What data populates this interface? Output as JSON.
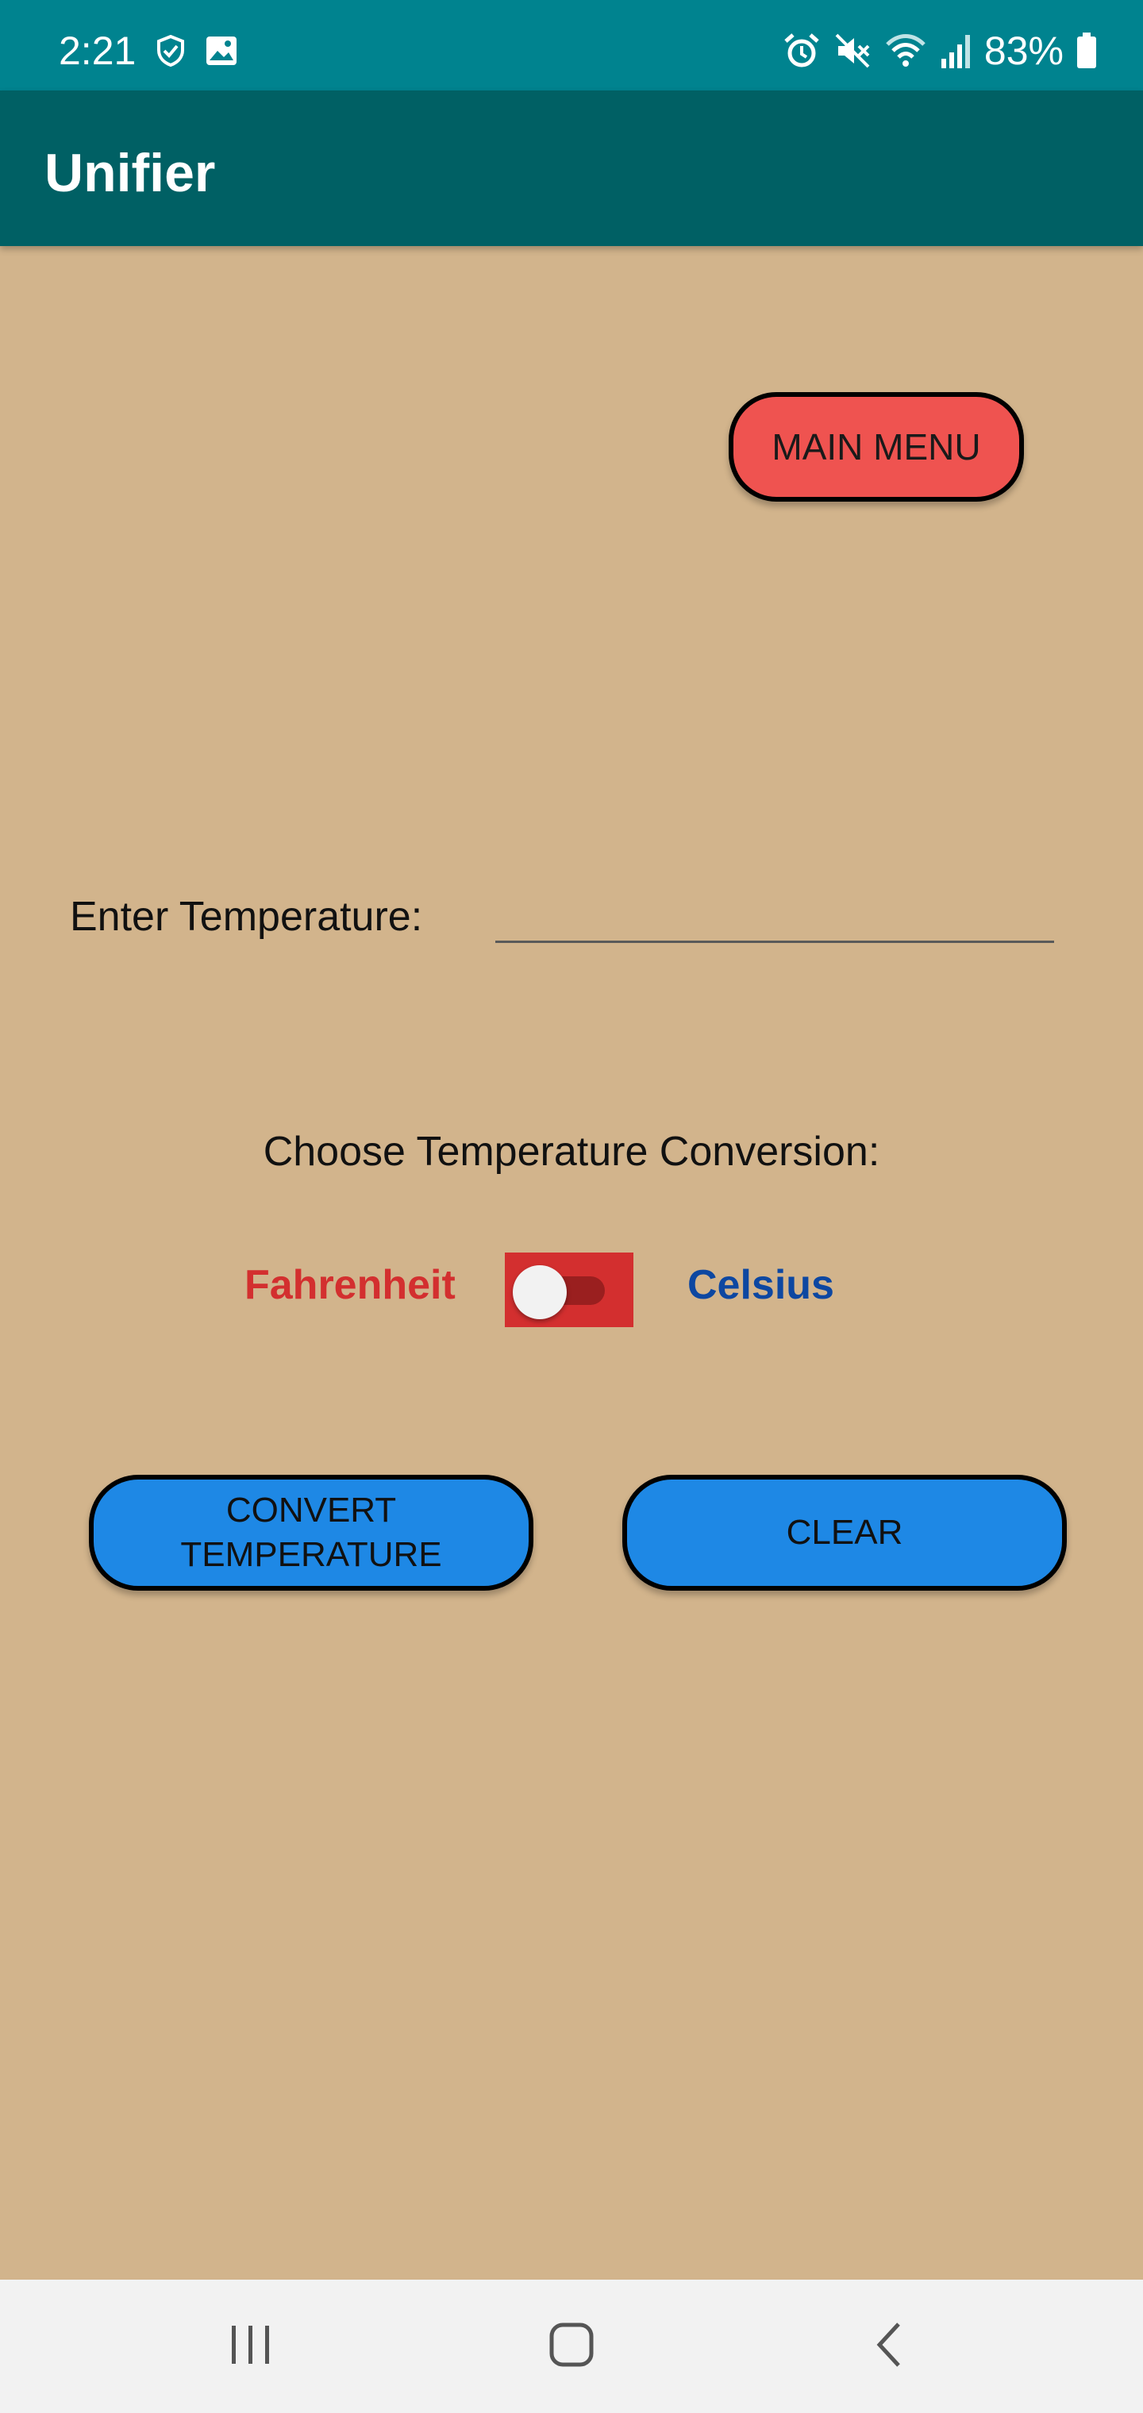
{
  "status_bar": {
    "time": "2:21",
    "battery": "83%",
    "icons": [
      "shield-icon",
      "image-icon",
      "alarm-icon",
      "mute-icon",
      "wifi-icon",
      "signal-icon",
      "battery-icon"
    ]
  },
  "app_bar": {
    "title": "Unifier",
    "color": "#006064"
  },
  "main": {
    "background": "#d2b48c",
    "main_menu_label": "MAIN MENU",
    "enter_temperature_label": "Enter Temperature:",
    "temperature_input_value": "",
    "choose_conversion_label": "Choose Temperature Conversion:",
    "toggle": {
      "left_label": "Fahrenheit",
      "right_label": "Celsius",
      "checked": false
    },
    "convert_label_line1": "CONVERT",
    "convert_label_line2": "TEMPERATURE",
    "clear_label": "CLEAR"
  },
  "nav_bar": {
    "buttons": [
      "recents-icon",
      "home-icon",
      "back-icon"
    ]
  }
}
